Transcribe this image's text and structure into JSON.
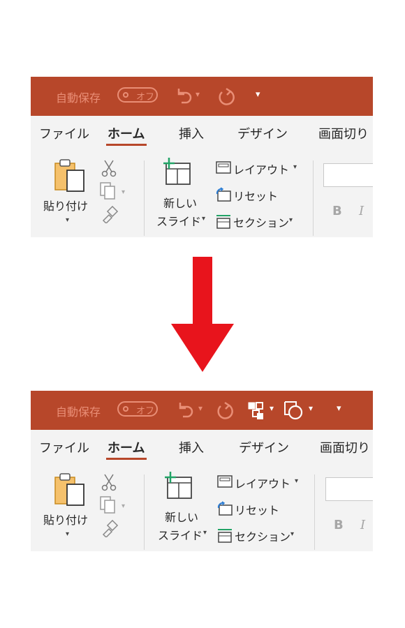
{
  "autosave": {
    "label": "自動保存",
    "toggle_state": "オフ"
  },
  "qat_more_symbol": "▾",
  "tabs": [
    {
      "label": "ファイル",
      "active": false
    },
    {
      "label": "ホーム",
      "active": true
    },
    {
      "label": "挿入",
      "active": false
    },
    {
      "label": "デザイン",
      "active": false
    },
    {
      "label": "画面切り",
      "active": false
    }
  ],
  "clipboard": {
    "paste_line1": "貼り付け",
    "paste_caret": "▾"
  },
  "slides": {
    "new_slide_line1": "新しい",
    "new_slide_line2": "スライド",
    "layout": "レイアウト",
    "reset": "リセット",
    "section": "セクション",
    "caret": "▾"
  },
  "font": {
    "bold": "B",
    "italic": "I"
  },
  "colors": {
    "titlebar": "#b7472a",
    "arrow": "#e8141c",
    "accent_green": "#21a366"
  },
  "added_qat_items": [
    "select-shapes-icon",
    "shape-format-icon"
  ]
}
